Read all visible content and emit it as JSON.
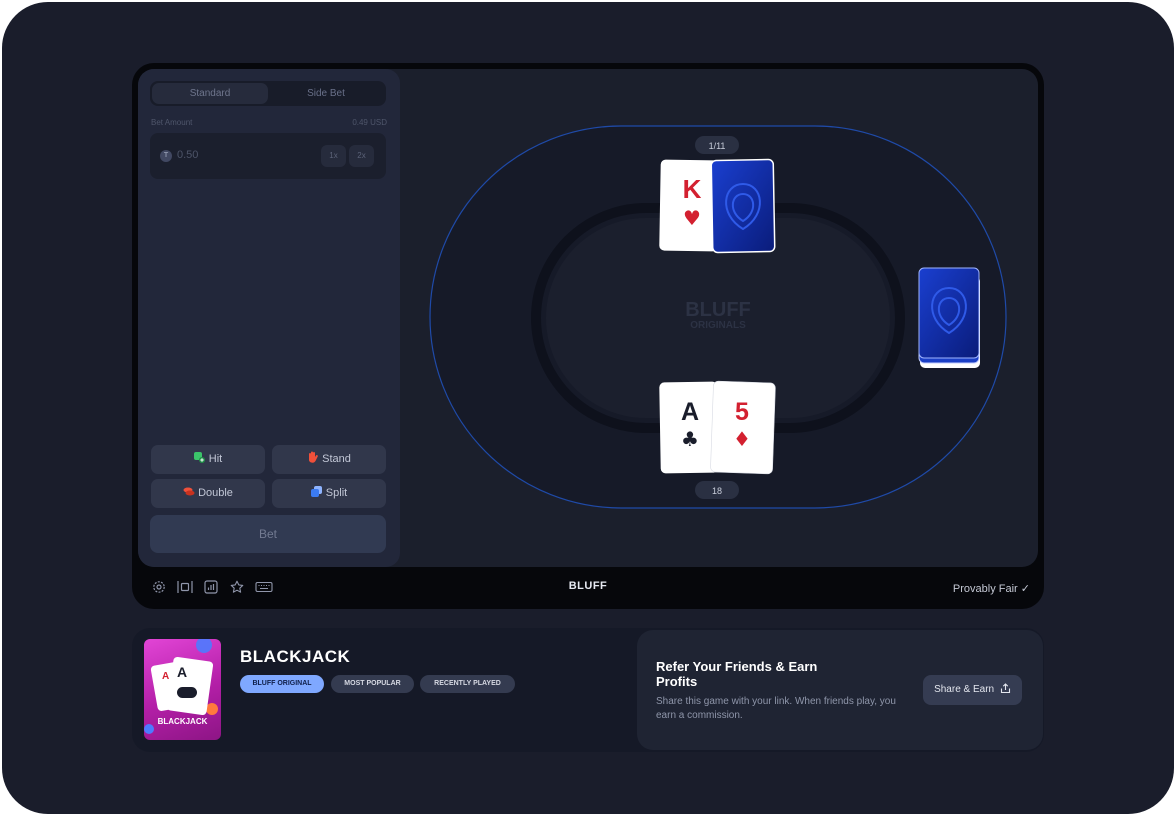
{
  "controls": {
    "tabs": [
      "Standard",
      "Side Bet"
    ],
    "bet_amount_label": "Bet Amount",
    "bet_amount_usd": "0.49 USD",
    "bet_value": "0.50",
    "coin_symbol": "T",
    "half_label": "1x",
    "double_label": "2x",
    "hit_label": "Hit",
    "stand_label": "Stand",
    "double_action_label": "Double",
    "split_label": "Split",
    "bet_label": "Bet"
  },
  "table": {
    "dealer_score": "1/11",
    "player_score": "18",
    "logo_top": "BLUFF",
    "logo_bottom": "ORIGINALS",
    "dealer_cards": [
      {
        "rank": "K",
        "suit": "♥",
        "color": "#d32030"
      },
      {
        "rank": "",
        "suit": "",
        "face_down": true
      }
    ],
    "player_cards": [
      {
        "rank": "A",
        "suit": "♣",
        "color": "#1a1d2b"
      },
      {
        "rank": "5",
        "suit": "♦",
        "color": "#d32030"
      }
    ]
  },
  "footer": {
    "brand": "BLUFF",
    "provably_fair": "Provably Fair ✓",
    "icons": [
      "settings-icon",
      "theatre-icon",
      "stats-icon",
      "favorite-icon",
      "keyboard-icon"
    ]
  },
  "game_info": {
    "title": "BLACKJACK",
    "thumb_label": "BLACKJACK",
    "tags": [
      "BLUFF ORIGINAL",
      "MOST POPULAR",
      "RECENTLY PLAYED"
    ]
  },
  "referral": {
    "title": "Refer Your Friends & Earn Profits",
    "text": "Share this game with your link. When friends play, you earn a commission.",
    "button_label": "Share & Earn"
  },
  "colors": {
    "accent_blue": "#7fa8ff",
    "hit_green": "#3bc46a",
    "stand_red": "#f0503a",
    "split_blue": "#3b7bf2"
  }
}
